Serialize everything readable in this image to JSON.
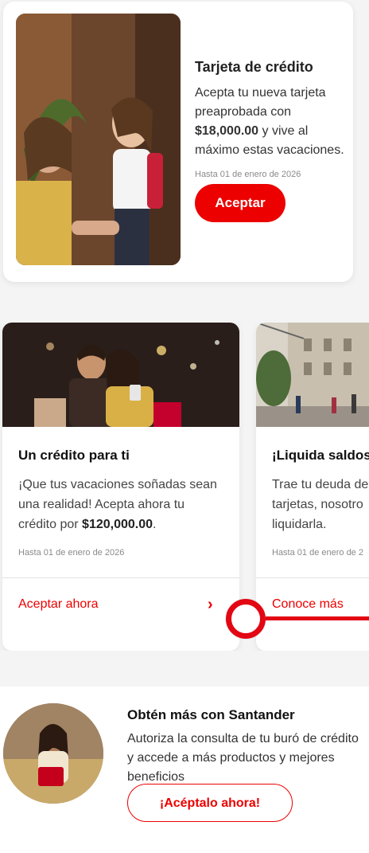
{
  "promo_card": {
    "title": "Tarjeta de crédito",
    "text_before": "Acepta tu nueva tarjeta preaprobada con ",
    "amount": "$18,000.00",
    "text_after": " y vive al máximo estas vacaciones.",
    "valid_until": "Hasta 01 de enero de 2026",
    "button_label": "Aceptar"
  },
  "carousel": [
    {
      "title": "Un crédito para ti",
      "line1": "¡Que tus vacaciones soñadas sean",
      "line2": "una realidad! Acepta ahora tu",
      "line3_prefix": "crédito por ",
      "amount": "$120,000.00",
      "line3_suffix": ".",
      "valid_until": "Hasta 01 de enero de 2026",
      "link_label": "Aceptar ahora",
      "chevron": "›"
    },
    {
      "title": "¡Liquida saldos",
      "line1": "Trae tu deuda de",
      "line2": "tarjetas, nosotro",
      "line3": "liquidarla.",
      "valid_until": "Hasta 01 de enero de 2",
      "link_label": "Conoce más"
    }
  ],
  "santander": {
    "title": "Obtén más con Santander",
    "text": "Autoriza la consulta de tu buró de crédito y accede a más productos y mejores beneficios",
    "button_label": "¡Acéptalo ahora!"
  },
  "colors": {
    "brand_red": "#ec0000",
    "tap_indicator": "#e30613"
  }
}
